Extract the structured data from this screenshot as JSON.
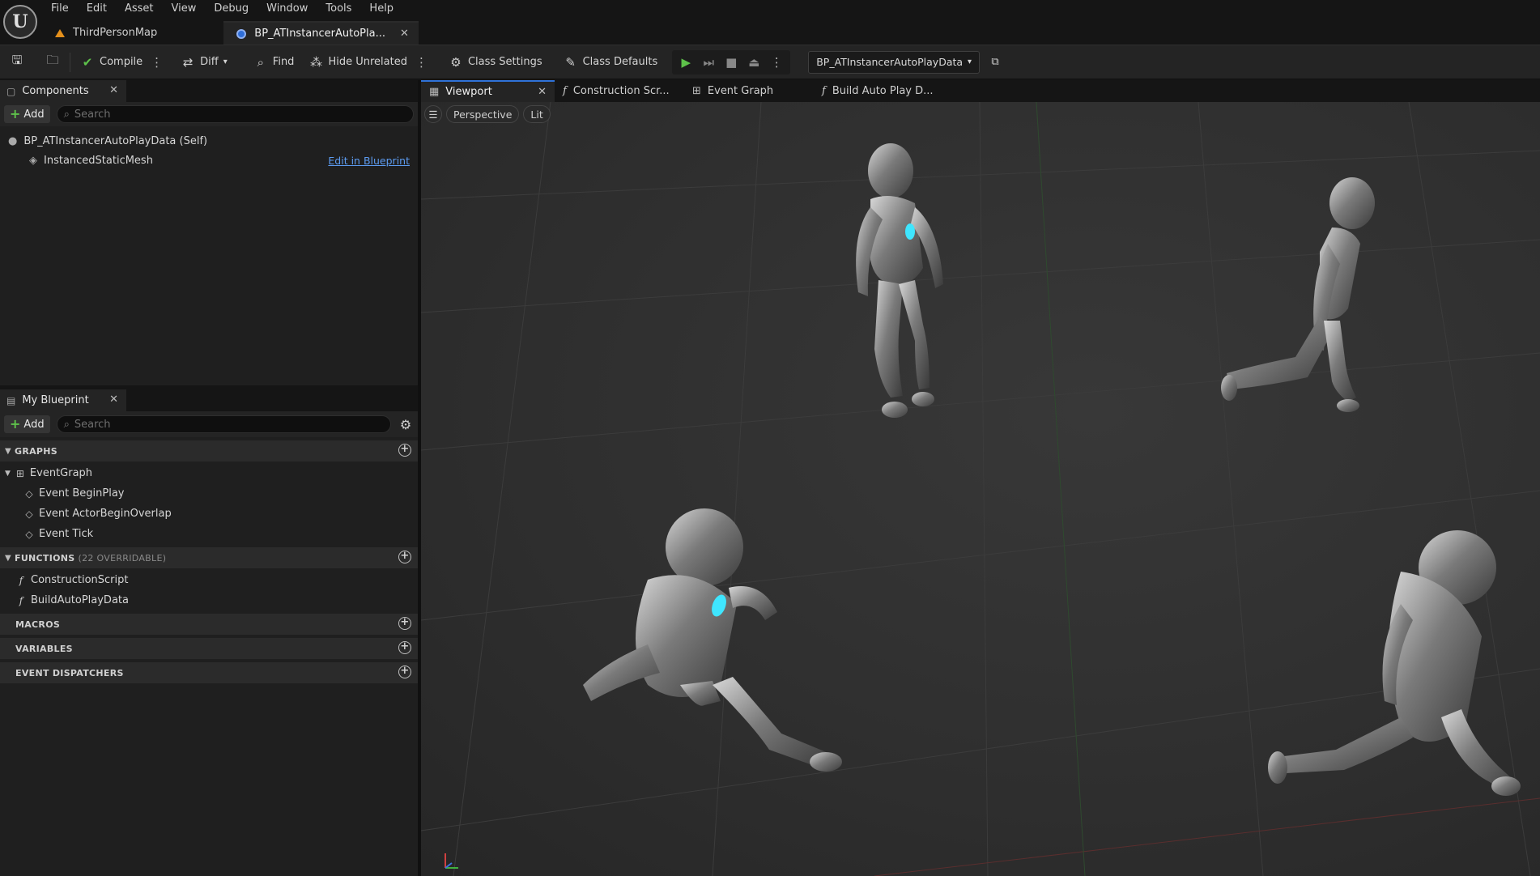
{
  "app": {
    "logo": "U",
    "menu": [
      "File",
      "Edit",
      "Asset",
      "View",
      "Debug",
      "Window",
      "Tools",
      "Help"
    ],
    "doc_tabs": [
      {
        "label": "ThirdPersonMap"
      },
      {
        "label": "BP_ATInstancerAutoPla..."
      }
    ]
  },
  "toolbar": {
    "compile": "Compile",
    "diff": "Diff",
    "find": "Find",
    "hide_unrelated": "Hide Unrelated",
    "class_settings": "Class Settings",
    "class_defaults": "Class Defaults",
    "debug_object": "BP_ATInstancerAutoPlayData"
  },
  "components": {
    "tab_label": "Components",
    "add_label": "Add",
    "search_placeholder": "Search",
    "self_label": "BP_ATInstancerAutoPlayData (Self)",
    "child_label": "InstancedStaticMesh",
    "edit_link": "Edit in Blueprint"
  },
  "my_blueprint": {
    "tab_label": "My Blueprint",
    "add_label": "Add",
    "search_placeholder": "Search",
    "graphs": {
      "title": "GRAPHS",
      "root": "EventGraph",
      "items": [
        "Event BeginPlay",
        "Event ActorBeginOverlap",
        "Event Tick"
      ]
    },
    "functions": {
      "title": "FUNCTIONS",
      "sub": "(22 OVERRIDABLE)",
      "items": [
        "ConstructionScript",
        "BuildAutoPlayData"
      ]
    },
    "macros": "MACROS",
    "variables": "VARIABLES",
    "dispatchers": "EVENT DISPATCHERS"
  },
  "editor_tabs": [
    "Viewport",
    "Construction Scr...",
    "Event Graph",
    "Build Auto Play D..."
  ],
  "viewport": {
    "perspective": "Perspective",
    "lit": "Lit"
  },
  "colors": {
    "accent": "#2f72d8",
    "play_green": "#5ec24a",
    "link": "#5c9bf0",
    "glow": "#3fe6ff"
  }
}
